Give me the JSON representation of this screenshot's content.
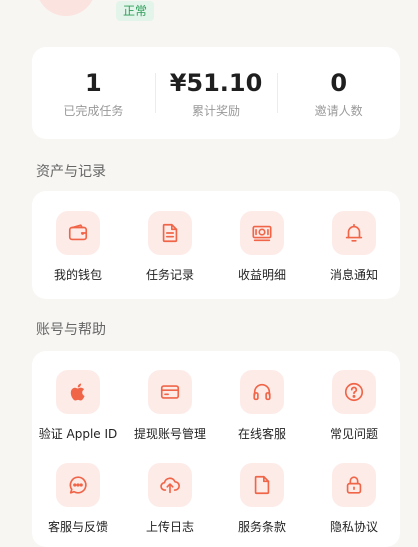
{
  "profile": {
    "status": "正常"
  },
  "stats": [
    {
      "value": "1",
      "label": "已完成任务"
    },
    {
      "value": "¥51.10",
      "label": "累计奖励"
    },
    {
      "value": "0",
      "label": "邀请人数"
    }
  ],
  "assets": {
    "title": "资产与记录",
    "items": [
      {
        "label": "我的钱包",
        "icon": "wallet-icon"
      },
      {
        "label": "任务记录",
        "icon": "document-icon"
      },
      {
        "label": "收益明细",
        "icon": "banknote-icon"
      },
      {
        "label": "消息通知",
        "icon": "bell-icon"
      }
    ]
  },
  "account": {
    "title": "账号与帮助",
    "items": [
      {
        "label": "验证 Apple ID",
        "icon": "apple-icon"
      },
      {
        "label": "提现账号管理",
        "icon": "credit-card-icon"
      },
      {
        "label": "在线客服",
        "icon": "headphones-icon"
      },
      {
        "label": "常见问题",
        "icon": "question-icon"
      },
      {
        "label": "客服与反馈",
        "icon": "chat-icon"
      },
      {
        "label": "上传日志",
        "icon": "cloud-upload-icon"
      },
      {
        "label": "服务条款",
        "icon": "file-icon"
      },
      {
        "label": "隐私协议",
        "icon": "lock-icon"
      }
    ]
  },
  "colors": {
    "accent": "#f06548",
    "icon_bg": "#fdebe8",
    "status_bg": "#e3f5ea",
    "status_text": "#2e9d5a"
  }
}
